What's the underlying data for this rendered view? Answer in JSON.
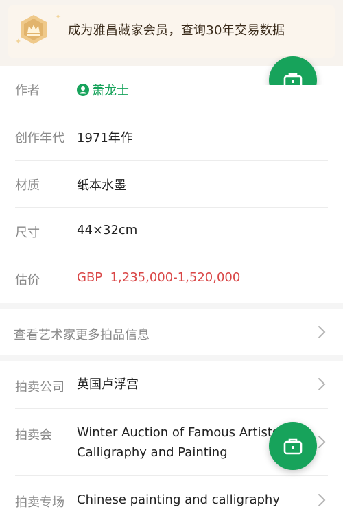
{
  "banner": {
    "text": "成为雅昌藏家会员，查询30年交易数据",
    "badge_icon": "vip-crown-badge-icon",
    "colors": {
      "background": "#fbf5ed",
      "badge": "#e2b46c"
    }
  },
  "details": {
    "artist_label": "作者",
    "artist_name": "萧龙士",
    "artist_icon": "user-circle-icon",
    "year_label": "创作年代",
    "year_value": "1971年作",
    "material_label": "材质",
    "material_value": "纸本水墨",
    "size_label": "尺寸",
    "size_value": "44×32cm",
    "estimate_label": "估价",
    "estimate_value": "GBP  1,235,000-1,520,000"
  },
  "more_link": {
    "label": "查看艺术家更多拍品信息",
    "icon": "chevron-right-icon"
  },
  "auction": {
    "company_label": "拍卖公司",
    "company_value": "英国卢浮宫",
    "session_label": "拍卖会",
    "session_value": "Winter Auction of Famous Artists Calligraphy and Painting",
    "special_label": "拍卖专场",
    "special_value": "Chinese painting and calligraphy"
  },
  "fab": {
    "icon": "briefcase-icon"
  },
  "colors": {
    "accent": "#17a35b",
    "price": "#d94646",
    "label": "#8a8a8a"
  }
}
